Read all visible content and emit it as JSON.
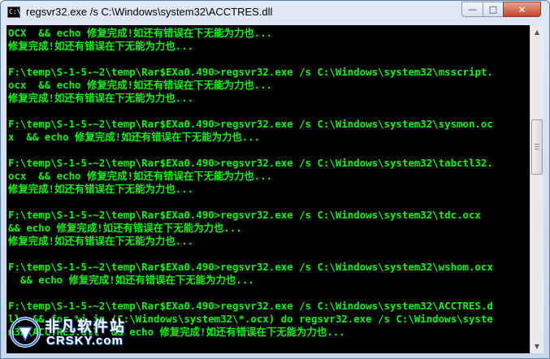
{
  "window": {
    "title": "regsvr32.exe  /s C:\\Windows\\system32\\ACCTRES.dll",
    "icon_text": "C:\\",
    "buttons": {
      "minimize": "—",
      "maximize": "□",
      "close": "✕"
    }
  },
  "console": {
    "lines": [
      "OCX  && echo 修复完成!如还有错误在下无能为力也...",
      "修复完成!如还有错误在下无能为力也...",
      "",
      "F:\\temp\\S-1-5-~2\\temp\\Rar$EXa0.490>regsvr32.exe /s C:\\Windows\\system32\\msscript.",
      "ocx  && echo 修复完成!如还有错误在下无能为力也...",
      "修复完成!如还有错误在下无能为力也...",
      "",
      "F:\\temp\\S-1-5-~2\\temp\\Rar$EXa0.490>regsvr32.exe /s C:\\Windows\\system32\\sysmon.oc",
      "x  && echo 修复完成!如还有错误在下无能为力也...",
      "",
      "F:\\temp\\S-1-5-~2\\temp\\Rar$EXa0.490>regsvr32.exe /s C:\\Windows\\system32\\tabctl32.",
      "ocx  && echo 修复完成!如还有错误在下无能为力也...",
      "修复完成!如还有错误在下无能为力也...",
      "",
      "F:\\temp\\S-1-5-~2\\temp\\Rar$EXa0.490>regsvr32.exe /s C:\\Windows\\system32\\tdc.ocx",
      "&& echo 修复完成!如还有错误在下无能为力也...",
      "修复完成!如还有错误在下无能为力也...",
      "",
      "F:\\temp\\S-1-5-~2\\temp\\Rar$EXa0.490>regsvr32.exe /s C:\\Windows\\system32\\wshom.ocx",
      "  && echo 修复完成!如还有错误在下无能为力也...",
      "",
      "F:\\temp\\S-1-5-~2\\temp\\Rar$EXa0.490>regsvr32.exe /s C:\\Windows\\system32\\ACCTRES.d",
      "ll  && for %i in (C:\\Windows\\system32\\*.ocx) do regsvr32.exe /s C:\\Windows\\syste",
      "m32\\ACCTRES.dll  && echo 修复完成!如还有错误在下无能为力也..."
    ]
  },
  "watermark": {
    "cn": "非凡软件站",
    "en": "CRSKY.com"
  },
  "colors": {
    "console_bg": "#000000",
    "console_text": "#0df50d",
    "titlebar": "#c7d7ec"
  }
}
